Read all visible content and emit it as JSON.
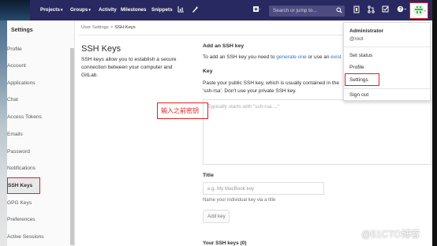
{
  "navbar": {
    "projects": "Projects",
    "groups": "Groups",
    "activity": "Activity",
    "milestones": "Milestones",
    "snippets": "Snippets",
    "search_placeholder": "Search or jump to..."
  },
  "sidebar": {
    "header": "Settings",
    "items": [
      {
        "label": "Profile",
        "icon": "user-icon"
      },
      {
        "label": "Account",
        "icon": "gear-icon"
      },
      {
        "label": "Applications",
        "icon": "applications-icon"
      },
      {
        "label": "Chat",
        "icon": "chat-icon"
      },
      {
        "label": "Access Tokens",
        "icon": "key-icon"
      },
      {
        "label": "Emails",
        "icon": "mail-icon"
      },
      {
        "label": "Password",
        "icon": "lock-icon"
      },
      {
        "label": "Notifications",
        "icon": "bell-icon"
      },
      {
        "label": "SSH Keys",
        "icon": "key-icon"
      },
      {
        "label": "GPG Keys",
        "icon": "key-icon"
      },
      {
        "label": "Preferences",
        "icon": "preferences-icon"
      },
      {
        "label": "Active Sessions",
        "icon": "sessions-icon"
      }
    ]
  },
  "breadcrumb": {
    "parent": "User Settings",
    "separator": ">",
    "current": "SSH Keys"
  },
  "page": {
    "title": "SSH Keys",
    "description": "SSH keys allow you to establish a secure connection between your computer and GitLab."
  },
  "form": {
    "section_title": "Add an SSH key",
    "intro_prefix": "To add an SSH key you need to",
    "intro_link1": "generate one",
    "intro_mid": "or use an",
    "intro_link2": "exist",
    "key_label": "Key",
    "key_help": "Paste your public SSH key, which is usually contained in the 'ssh-rsa'. Don't use your private SSH key.",
    "key_placeholder": "Typically starts with \"ssh-rsa ...\"",
    "title_label": "Title",
    "title_placeholder": "e.g. My MacBook key",
    "title_help": "Name your individual key via a title",
    "add_button": "Add key",
    "your_keys": "Your SSH keys (0)"
  },
  "annotation": "输入之前密钥",
  "dropdown": {
    "name": "Administrator",
    "username": "@root",
    "set_status": "Set status",
    "profile": "Profile",
    "settings": "Settings",
    "sign_out": "Sign out"
  },
  "watermark": "@51CTO博客",
  "colors": {
    "navbar": "#292961",
    "link": "#1f78d1",
    "annotation": "#e02020"
  }
}
